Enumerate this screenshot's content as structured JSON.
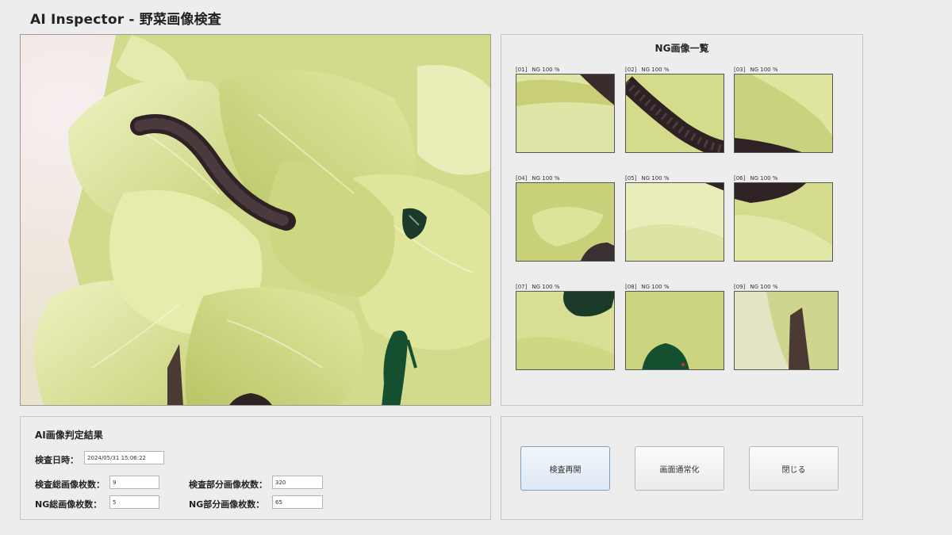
{
  "app": {
    "title": "AI Inspector - 野菜画像検査"
  },
  "ng_panel": {
    "title": "NG画像一覧",
    "thumbnails": [
      {
        "index": "[01]",
        "label": "NG 100 %"
      },
      {
        "index": "[02]",
        "label": "NG 100 %"
      },
      {
        "index": "[03]",
        "label": "NG 100 %"
      },
      {
        "index": "[04]",
        "label": "NG 100 %"
      },
      {
        "index": "[05]",
        "label": "NG 100 %"
      },
      {
        "index": "[06]",
        "label": "NG 100 %"
      },
      {
        "index": "[07]",
        "label": "NG 100 %"
      },
      {
        "index": "[08]",
        "label": "NG 100 %"
      },
      {
        "index": "[09]",
        "label": "NG 100 %"
      }
    ]
  },
  "result": {
    "title": "AI画像判定結果",
    "datetime_label": "検査日時：",
    "datetime_value": "2024/05/31 15:06:22",
    "total_images_label": "検査総画像枚数：",
    "total_images_value": "9",
    "ng_total_label": "NG総画像枚数：",
    "ng_total_value": "5",
    "parts_label": "検査部分画像枚数：",
    "parts_value": "320",
    "ng_parts_label": "NG部分画像枚数：",
    "ng_parts_value": "65"
  },
  "buttons": {
    "restart": "検査再開",
    "normalize": "画面通常化",
    "close": "閉じる"
  },
  "colors": {
    "background": "#ededed",
    "lettuce": "#d7df8f",
    "worm": "#3a2a2c",
    "beetle": "#1e4a32",
    "primary_button": "#dfe9f4"
  }
}
